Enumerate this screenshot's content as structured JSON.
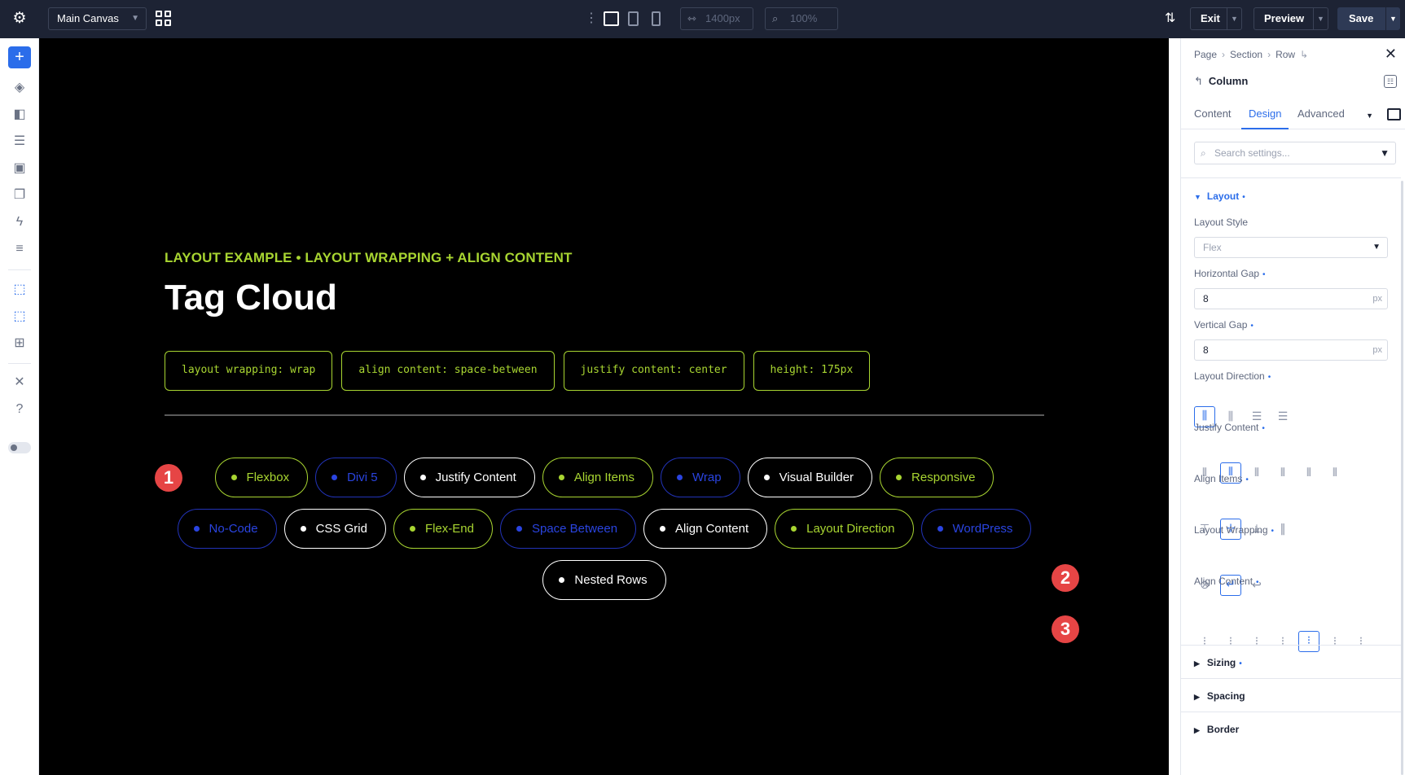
{
  "topbar": {
    "canvas_select": "Main Canvas",
    "width_value": "1400px",
    "zoom_value": "100%",
    "exit_label": "Exit",
    "preview_label": "Preview",
    "save_label": "Save"
  },
  "canvas": {
    "eyebrow": "LAYOUT EXAMPLE • LAYOUT WRAPPING + ALIGN CONTENT",
    "title": "Tag Cloud",
    "codes": [
      "layout wrapping: wrap",
      "align content: space-between",
      "justify content: center",
      "height: 175px"
    ],
    "tags": [
      {
        "label": "Flexbox",
        "style": "green"
      },
      {
        "label": "Divi 5",
        "style": "blue"
      },
      {
        "label": "Justify Content",
        "style": "white"
      },
      {
        "label": "Align Items",
        "style": "green"
      },
      {
        "label": "Wrap",
        "style": "blue"
      },
      {
        "label": "Visual Builder",
        "style": "white"
      },
      {
        "label": "Responsive",
        "style": "green"
      },
      {
        "label": "No-Code",
        "style": "blue"
      },
      {
        "label": "CSS Grid",
        "style": "white"
      },
      {
        "label": "Flex-End",
        "style": "green"
      },
      {
        "label": "Space Between",
        "style": "blue"
      },
      {
        "label": "Align Content",
        "style": "white"
      },
      {
        "label": "Layout Direction",
        "style": "green"
      },
      {
        "label": "WordPress",
        "style": "blue"
      },
      {
        "label": "Nested Rows",
        "style": "white"
      }
    ],
    "markers": [
      "1",
      "2",
      "3"
    ]
  },
  "panel": {
    "breadcrumb": [
      "Page",
      "Section",
      "Row"
    ],
    "element_name": "Column",
    "tabs": [
      "Content",
      "Design",
      "Advanced"
    ],
    "active_tab": "Design",
    "search_placeholder": "Search settings...",
    "layout_group": "Layout",
    "layout_style_label": "Layout Style",
    "layout_style_value": "Flex",
    "horizontal_gap_label": "Horizontal Gap",
    "horizontal_gap_value": "8",
    "vertical_gap_label": "Vertical Gap",
    "vertical_gap_value": "8",
    "unit": "px",
    "layout_direction_label": "Layout Direction",
    "justify_content_label": "Justify Content",
    "align_items_label": "Align Items",
    "layout_wrapping_label": "Layout Wrapping",
    "align_content_label": "Align Content",
    "collapsed_groups": [
      "Sizing",
      "Spacing",
      "Border"
    ]
  },
  "colors": {
    "accent_green": "#a8d531",
    "accent_blue": "#2b6dea",
    "marker_red": "#e64545",
    "topbar_bg": "#1d2334"
  }
}
